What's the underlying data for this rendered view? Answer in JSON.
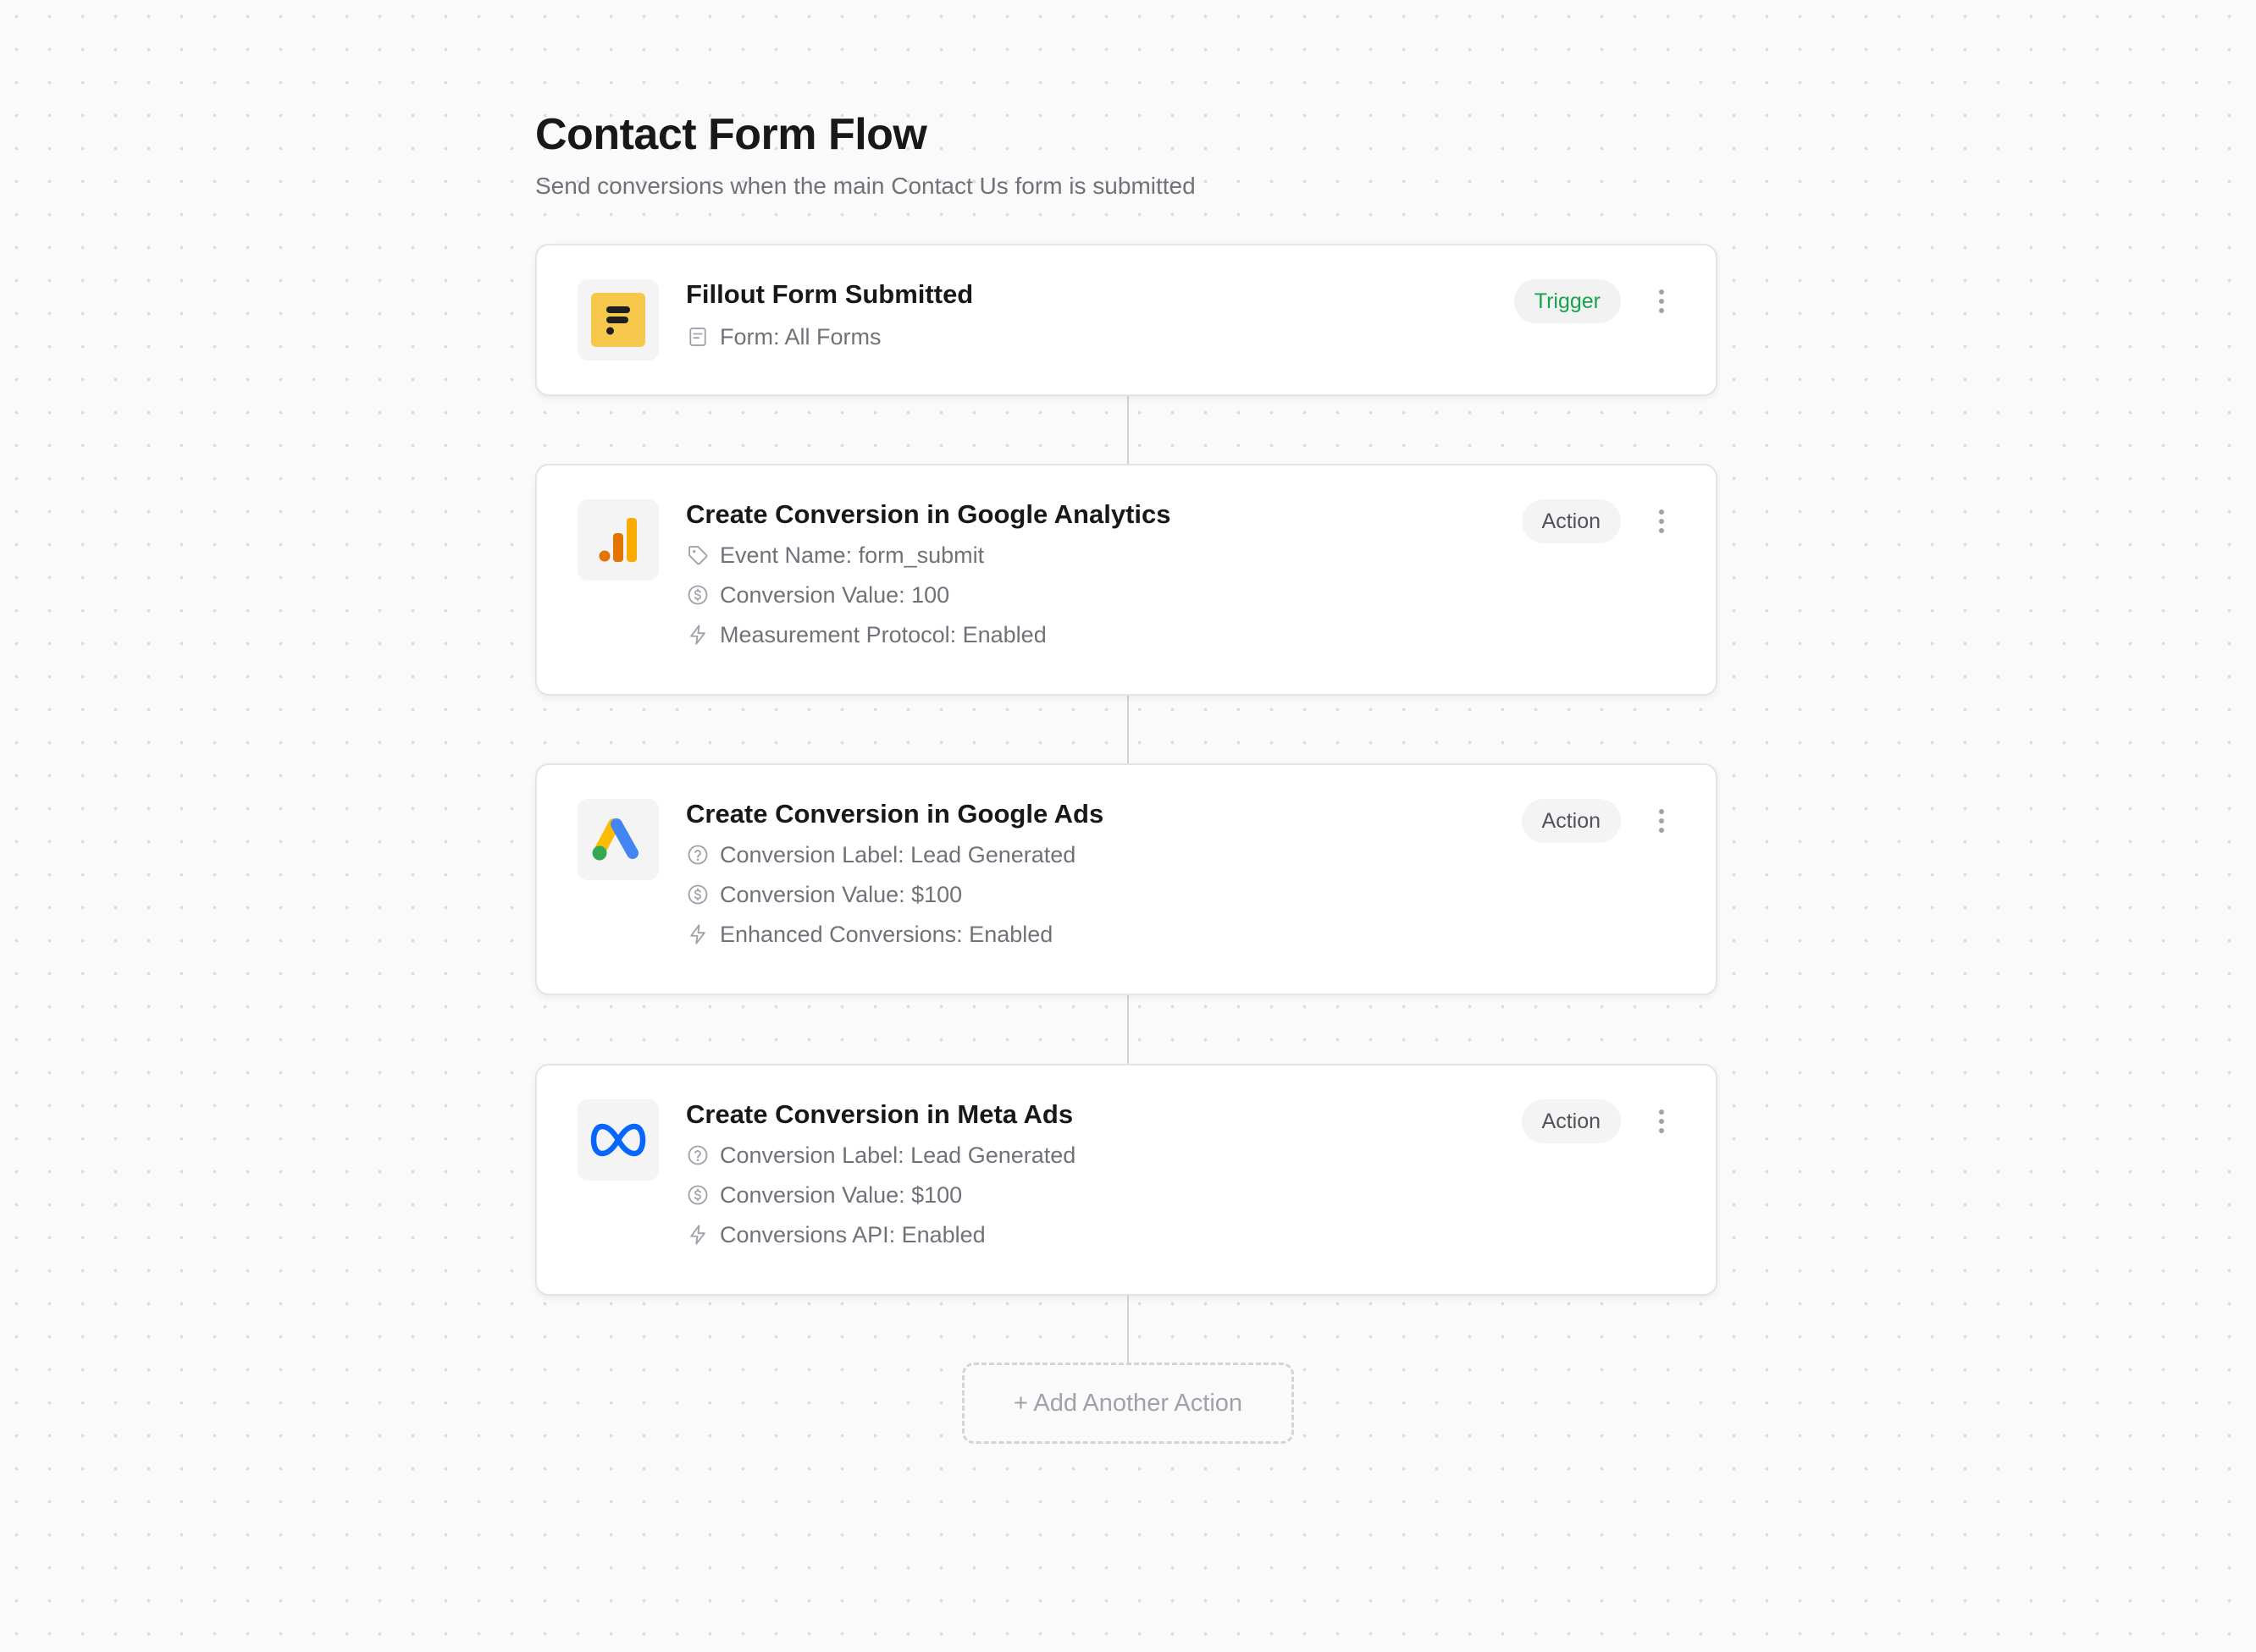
{
  "page": {
    "title": "Contact Form Flow",
    "subtitle": "Send conversions when the main Contact Us form is submitted"
  },
  "steps": [
    {
      "title": "Fillout Form Submitted",
      "badge": "Trigger",
      "logo": "fillout-logo",
      "details": [
        {
          "icon": "form-icon",
          "text": "Form: All Forms"
        }
      ]
    },
    {
      "title": "Create Conversion in Google Analytics",
      "badge": "Action",
      "logo": "google-analytics-logo",
      "details": [
        {
          "icon": "tag-icon",
          "text": "Event Name: form_submit"
        },
        {
          "icon": "dollar-circle-icon",
          "text": "Conversion Value: 100"
        },
        {
          "icon": "lightning-icon",
          "text": "Measurement Protocol: Enabled"
        }
      ]
    },
    {
      "title": "Create Conversion in Google Ads",
      "badge": "Action",
      "logo": "google-ads-logo",
      "details": [
        {
          "icon": "help-circle-icon",
          "text": "Conversion Label: Lead Generated"
        },
        {
          "icon": "dollar-circle-icon",
          "text": "Conversion Value: $100"
        },
        {
          "icon": "lightning-icon",
          "text": "Enhanced Conversions: Enabled"
        }
      ]
    },
    {
      "title": "Create Conversion in Meta Ads",
      "badge": "Action",
      "logo": "meta-logo",
      "details": [
        {
          "icon": "help-circle-icon",
          "text": "Conversion Label: Lead Generated"
        },
        {
          "icon": "dollar-circle-icon",
          "text": "Conversion Value: $100"
        },
        {
          "icon": "lightning-icon",
          "text": "Conversions API: Enabled"
        }
      ]
    }
  ],
  "add_action_label": "+ Add Another Action",
  "colors": {
    "background": "#fafafa",
    "card_border": "#e4e4e7",
    "trigger_badge_text": "#16a34a",
    "action_badge_text": "#52525b",
    "muted_text": "#71717a",
    "fillout_yellow": "#f5c84c",
    "ga_orange": "#f9ab00",
    "ga_dark_orange": "#e37400",
    "ads_blue": "#4285f4",
    "ads_yellow": "#fbbc04",
    "ads_green": "#34a853",
    "meta_blue": "#0866ff"
  }
}
